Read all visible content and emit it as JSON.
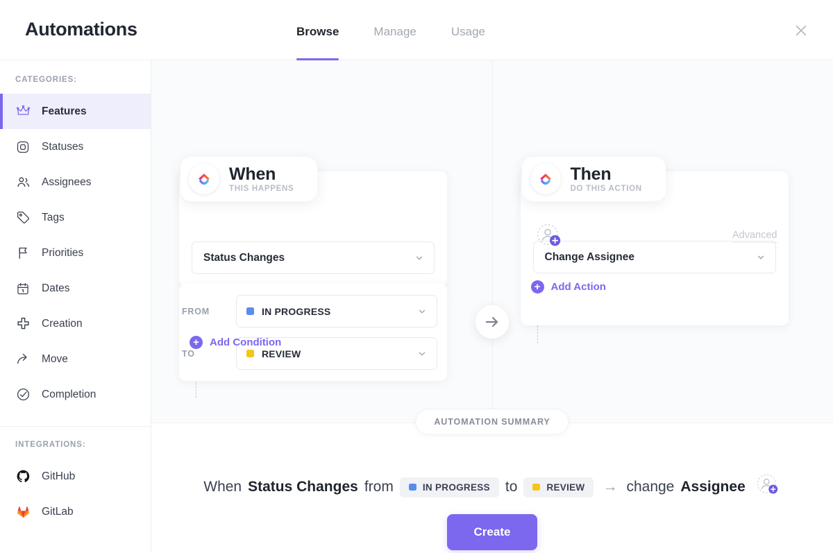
{
  "header": {
    "title": "Automations",
    "tabs": [
      {
        "label": "Browse",
        "active": true
      },
      {
        "label": "Manage",
        "active": false
      },
      {
        "label": "Usage",
        "active": false
      }
    ],
    "close_icon": "close-icon"
  },
  "sidebar": {
    "categories_label": "CATEGORIES:",
    "integrations_label": "INTEGRATIONS:",
    "categories": [
      {
        "label": "Features",
        "icon": "crown-icon",
        "active": true
      },
      {
        "label": "Statuses",
        "icon": "square-icon",
        "active": false
      },
      {
        "label": "Assignees",
        "icon": "people-icon",
        "active": false
      },
      {
        "label": "Tags",
        "icon": "tag-icon",
        "active": false
      },
      {
        "label": "Priorities",
        "icon": "flag-icon",
        "active": false
      },
      {
        "label": "Dates",
        "icon": "calendar-icon",
        "active": false
      },
      {
        "label": "Creation",
        "icon": "plus-icon",
        "active": false
      },
      {
        "label": "Move",
        "icon": "move-arrow-icon",
        "active": false
      },
      {
        "label": "Completion",
        "icon": "check-circle-icon",
        "active": false
      }
    ],
    "integrations": [
      {
        "label": "GitHub",
        "icon": "github-icon"
      },
      {
        "label": "GitLab",
        "icon": "gitlab-icon"
      }
    ]
  },
  "builder": {
    "when": {
      "heading": "When",
      "subheading": "THIS HAPPENS",
      "logo": "clickup-logo-icon",
      "trigger": "Status Changes",
      "conditions": [
        {
          "label": "FROM",
          "value": "IN PROGRESS",
          "color": "#5a8cf0"
        },
        {
          "label": "TO",
          "value": "REVIEW",
          "color": "#f5c518"
        }
      ],
      "add_condition": "Add Condition"
    },
    "then": {
      "heading": "Then",
      "subheading": "DO THIS ACTION",
      "logo": "clickup-logo-icon",
      "action": "Change Assignee",
      "assignee_placeholder": "add-assignee-icon",
      "advanced": "Advanced",
      "add_action": "Add Action"
    },
    "flow_arrow": "arrow-right-icon"
  },
  "summary": {
    "pill_label": "AUTOMATION SUMMARY",
    "when_word": "When",
    "trigger": "Status Changes",
    "from_word": "from",
    "from_status": {
      "value": "IN PROGRESS",
      "color": "#5a8cf0"
    },
    "to_word": "to",
    "to_status": {
      "value": "REVIEW",
      "color": "#f5c518"
    },
    "arrow": "→",
    "change_word": "change",
    "action_target": "Assignee",
    "avatar_icon": "add-assignee-icon",
    "create_label": "Create"
  },
  "colors": {
    "accent": "#7b68ee",
    "active_bg": "#efeefc",
    "canvas": "#fafbfc",
    "in_progress": "#5a8cf0",
    "review": "#f5c518"
  }
}
